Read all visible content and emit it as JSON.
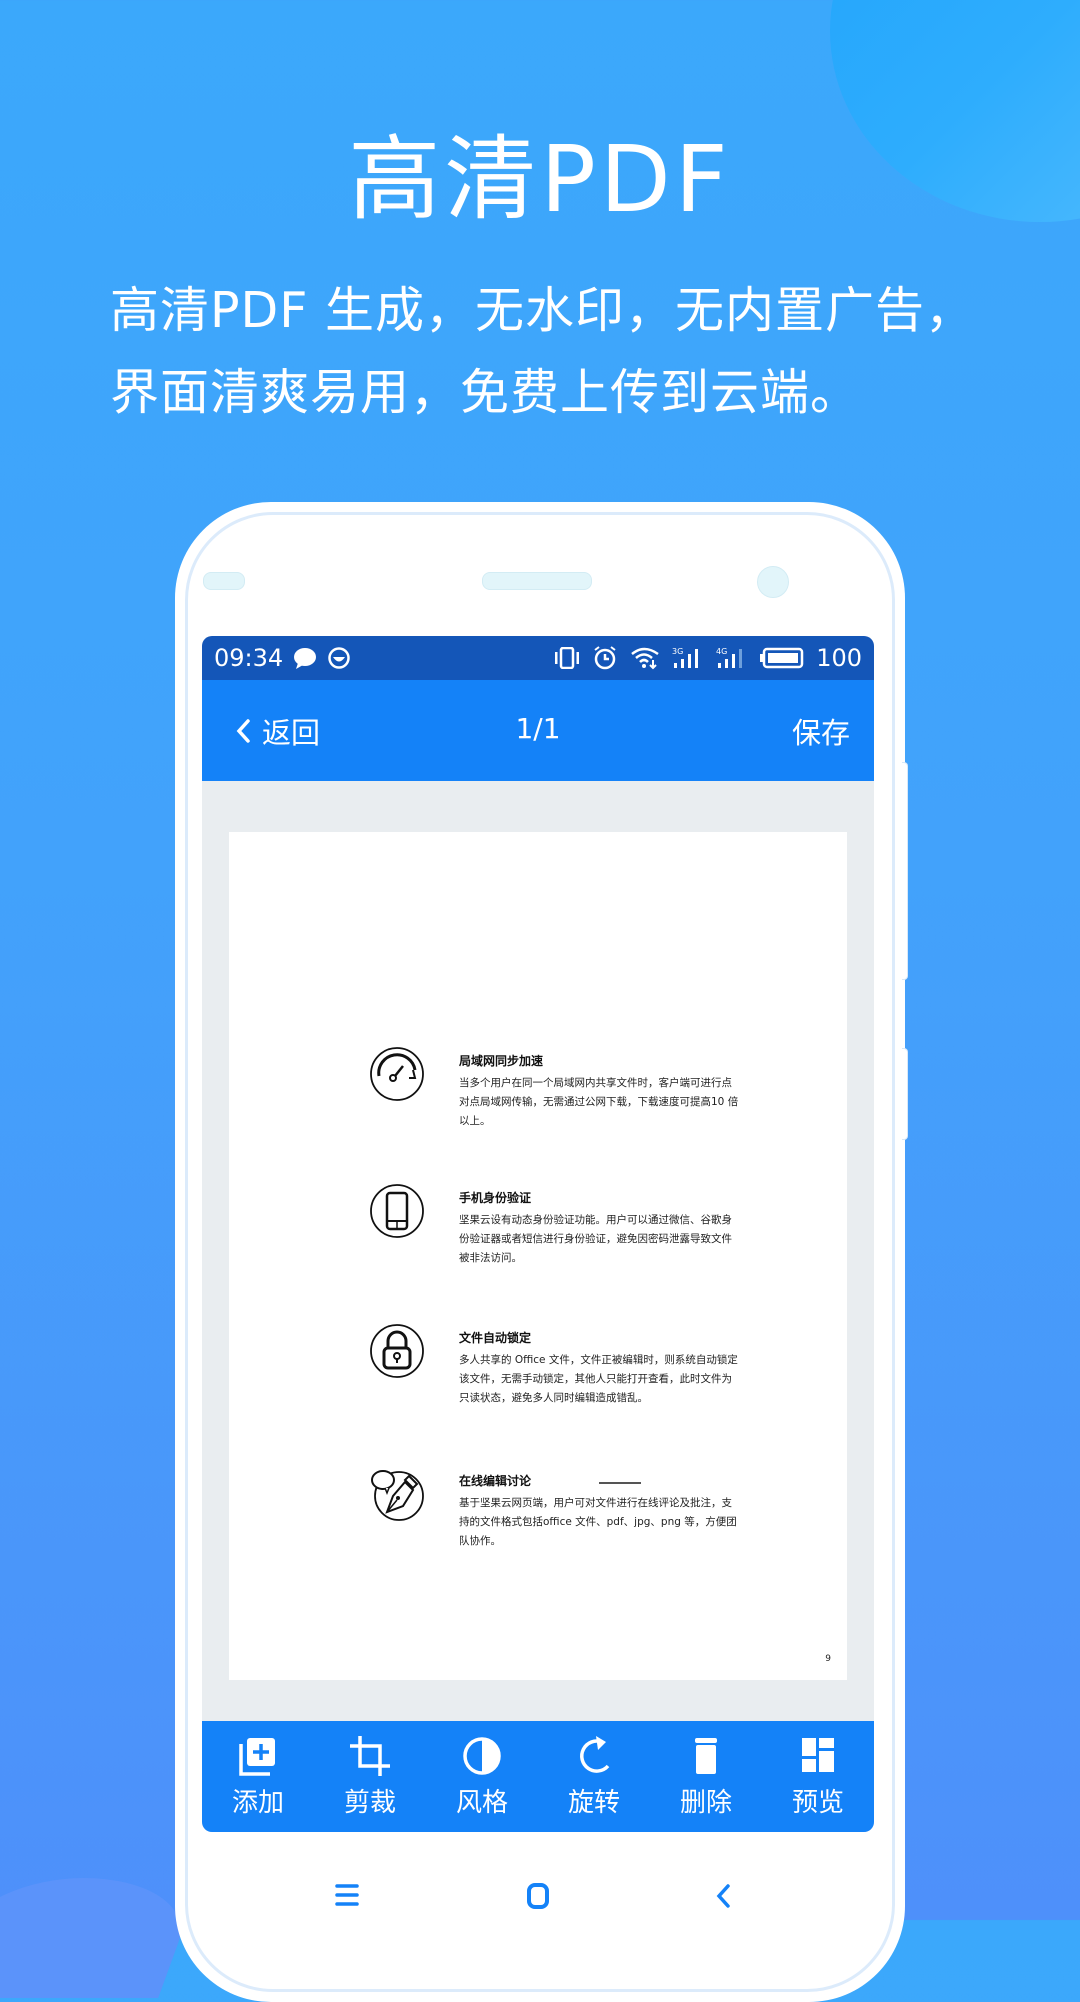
{
  "promo": {
    "headline": "高清PDF",
    "subtitle_lines": [
      "高清PDF 生成，无水印，无内置广告，",
      "界面清爽易用，免费上传到云端。"
    ]
  },
  "status_bar": {
    "time": "09:34",
    "left_icons": [
      "chat-bubble-icon",
      "app-notification-icon"
    ],
    "right_icons": [
      "vibrate-icon",
      "alarm-icon",
      "wifi-icon",
      "signal-3g-icon",
      "signal-4g-icon",
      "battery-icon"
    ],
    "signal_labels": [
      "3G",
      "4G"
    ],
    "battery": "100"
  },
  "app_bar": {
    "back_label": "返回",
    "page_indicator": "1/1",
    "save_label": "保存"
  },
  "document": {
    "features": [
      {
        "icon": "speedometer-icon",
        "title": "局域网同步加速",
        "description": "当多个用户在同一个局域网内共享文件时，客户端可进行点对点局域网传输，无需通过公网下载，下载速度可提高10 倍以上。"
      },
      {
        "icon": "smartphone-icon",
        "title": "手机身份验证",
        "description": "坚果云设有动态身份验证功能。用户可以通过微信、谷歌身份验证器或者短信进行身份验证，避免因密码泄露导致文件被非法访问。"
      },
      {
        "icon": "padlock-icon",
        "title": "文件自动锁定",
        "description": "多人共享的 Office 文件，文件正被编辑时，则系统自动锁定该文件，无需手动锁定，其他人只能打开查看，此时文件为只读状态，避免多人同时编辑造成错乱。"
      },
      {
        "icon": "pen-comment-icon",
        "title": "在线编辑讨论",
        "description": "基于坚果云网页端，用户可对文件进行在线评论及批注，支持的文件格式包括office 文件、pdf、jpg、png 等，方便团队协作。"
      }
    ],
    "page_number": "9"
  },
  "toolbar": {
    "items": [
      {
        "label": "添加",
        "icon": "add-page-icon"
      },
      {
        "label": "剪裁",
        "icon": "crop-icon"
      },
      {
        "label": "风格",
        "icon": "contrast-icon"
      },
      {
        "label": "旋转",
        "icon": "rotate-icon"
      },
      {
        "label": "删除",
        "icon": "trash-icon"
      },
      {
        "label": "预览",
        "icon": "grid-preview-icon"
      }
    ]
  },
  "nav_bar": {
    "buttons": [
      "menu-icon",
      "home-icon",
      "back-icon"
    ]
  },
  "colors": {
    "status_bar": "#1456b8",
    "app_bar": "#1482f8",
    "canvas": "#e9edf0",
    "nav_icon": "#1482f8"
  }
}
